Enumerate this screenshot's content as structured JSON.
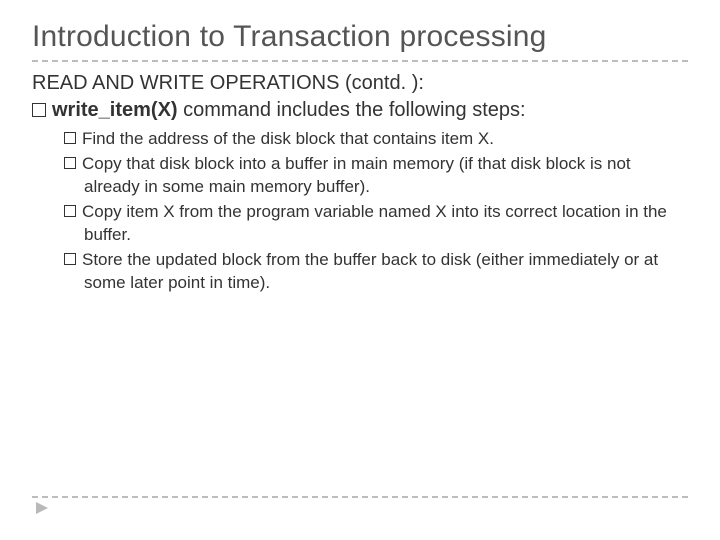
{
  "title": "Introduction to Transaction processing",
  "subhead": "READ AND WRITE OPERATIONS (contd. ):",
  "lead": {
    "bold": "write_item(X)",
    "rest": " command includes the following steps:"
  },
  "steps": [
    "Find the address of the disk block that contains item X.",
    "Copy that disk block into a buffer in main memory (if that disk block is not already in some main memory buffer).",
    "Copy item X from the program variable named X into its correct location in the buffer.",
    "Store the updated block from the buffer back to disk (either immediately or at some later point in time)."
  ]
}
